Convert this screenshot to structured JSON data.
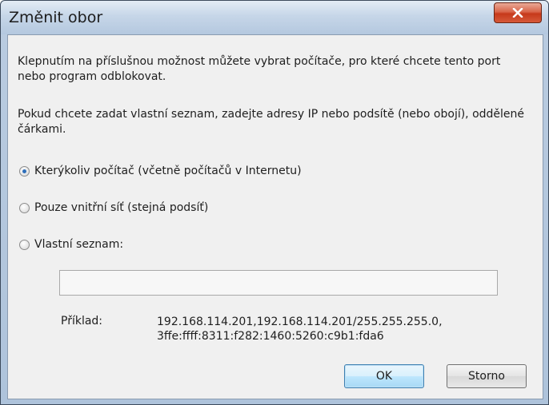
{
  "window": {
    "title": "Změnit obor",
    "close_icon": "close-icon"
  },
  "content": {
    "paragraph1": "Klepnutím na příslušnou možnost můžete vybrat počítače, pro které chcete tento port nebo program odblokovat.",
    "paragraph2": "Pokud chcete zadat vlastní seznam, zadejte adresy IP nebo podsítě (nebo obojí), oddělené čárkami."
  },
  "options": {
    "any": {
      "label": "Kterýkoliv počítač (včetně počítačů v Internetu)",
      "checked": true
    },
    "local": {
      "label": "Pouze vnitřní síť (stejná podsíť)",
      "checked": false
    },
    "custom": {
      "label": "Vlastní seznam:",
      "checked": false
    }
  },
  "custom_list": {
    "value": ""
  },
  "example": {
    "label": "Příklad:",
    "line1": "192.168.114.201,192.168.114.201/255.255.255.0,",
    "line2": "3ffe:ffff:8311:f282:1460:5260:c9b1:fda6"
  },
  "buttons": {
    "ok": "OK",
    "cancel": "Storno"
  }
}
